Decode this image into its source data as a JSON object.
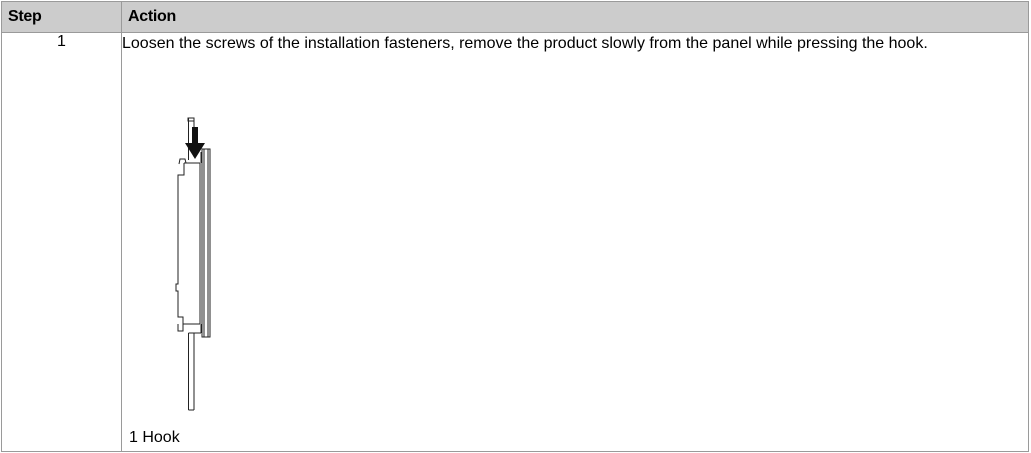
{
  "table": {
    "headers": {
      "step": "Step",
      "action": "Action"
    },
    "rows": [
      {
        "step": "1",
        "action": "Loosen the screws of the installation fasteners, remove the product slowly from the panel while pressing the hook.",
        "figure": {
          "icon": "panel-side-view-hook-illustration",
          "caption": "1 Hook"
        }
      }
    ]
  }
}
